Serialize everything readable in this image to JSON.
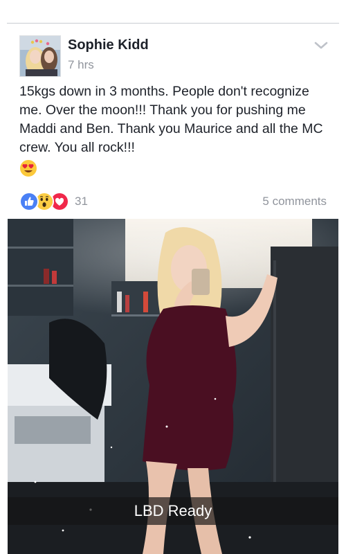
{
  "post": {
    "author": "Sophie Kidd",
    "timestamp": "7 hrs",
    "text": "15kgs down in 3 months. People don't recognize me. Over the moon!!! Thank you for pushing me Maddi and Ben. Thank you Maurice and all the MC crew. You all rock!!!",
    "emoji": "heart-eyes-emoji",
    "options_icon": "chevron-down-icon"
  },
  "reactions": {
    "icons": [
      "like-icon",
      "wow-icon",
      "love-icon"
    ],
    "count": "31",
    "comments": "5 comments"
  },
  "photo": {
    "caption": "LBD Ready"
  },
  "colors": {
    "like": "#4a80f5",
    "love": "#f0284a",
    "wow": "#fbcd44",
    "meta_text": "#90949c",
    "body_text": "#1d2129"
  }
}
